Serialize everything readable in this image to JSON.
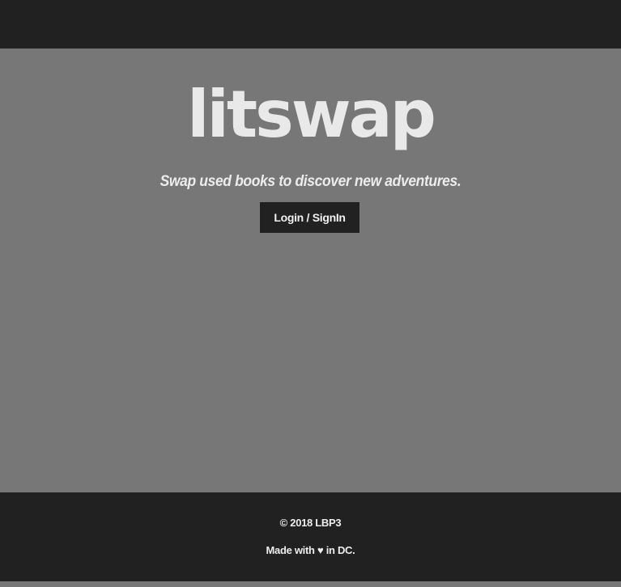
{
  "header": {},
  "hero": {
    "logo_text": "litswap",
    "tagline": "Swap used books to discover new adventures.",
    "login_label": "Login / SignIn"
  },
  "footer": {
    "copyright": "© 2018 LBP3",
    "made_with_prefix": "Made with",
    "heart_glyph": "♥",
    "made_with_suffix": "in DC."
  },
  "colors": {
    "background": "#777777",
    "bars": "#212121",
    "text": "#ededed"
  }
}
